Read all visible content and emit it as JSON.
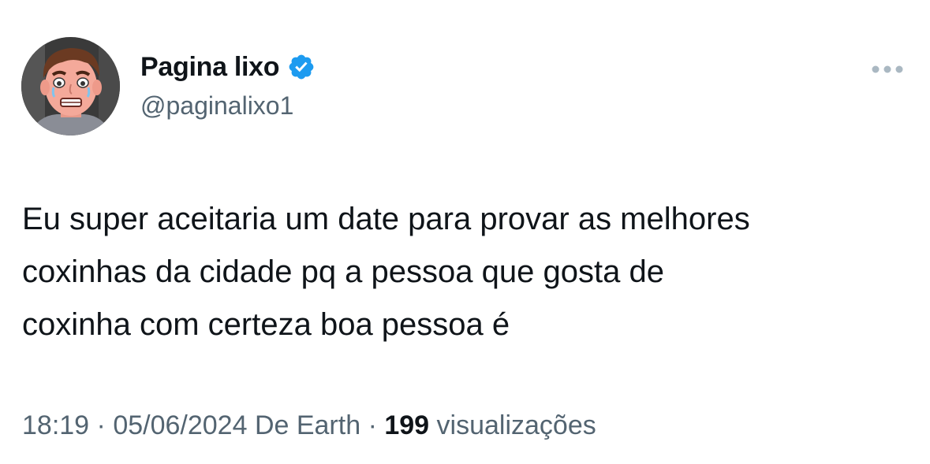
{
  "author": {
    "display_name": "Pagina lixo",
    "handle": "@paginalixo1",
    "verified": true,
    "avatar_icon": "cartoon-face-avatar",
    "verified_icon": "verified-badge-icon",
    "verified_color": "#1d9bf0"
  },
  "menu": {
    "icon": "more-options-icon"
  },
  "tweet": {
    "text": "Eu super aceitaria um date para provar as melhores\ncoxinhas da cidade pq a pessoa que gosta de\ncoxinha com certeza boa pessoa é"
  },
  "meta": {
    "time": "18:19",
    "separator": " · ",
    "date": "05/06/2024",
    "source": "De Earth",
    "views_count": "199",
    "views_label": "visualizações"
  },
  "colors": {
    "text_primary": "#0f1419",
    "text_secondary": "#536471",
    "background": "#ffffff"
  }
}
